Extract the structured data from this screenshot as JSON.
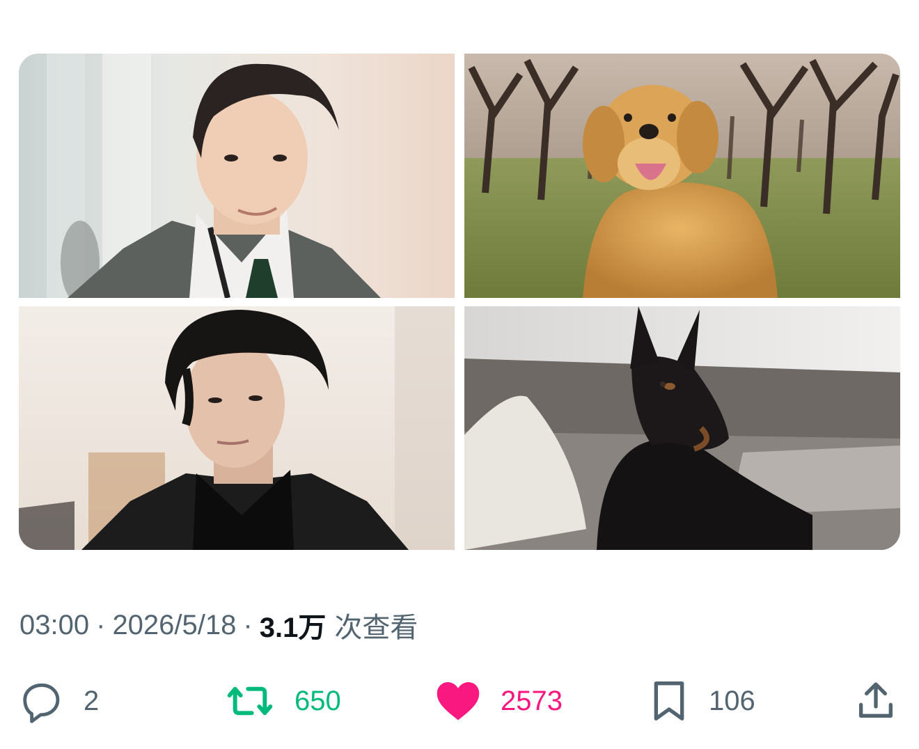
{
  "tweet": {
    "media": [
      {
        "name": "photo-man-grey-suit",
        "alt": ""
      },
      {
        "name": "photo-golden-retriever",
        "alt": ""
      },
      {
        "name": "photo-man-black-suit",
        "alt": ""
      },
      {
        "name": "photo-doberman",
        "alt": ""
      }
    ],
    "meta": {
      "time": "03:00",
      "separator": "·",
      "date": "2026/5/18",
      "views_count": "3.1万",
      "views_label": "次查看"
    },
    "actions": {
      "reply": {
        "icon": "reply-icon",
        "count": "2",
        "color": "#536471"
      },
      "retweet": {
        "icon": "retweet-icon",
        "count": "650",
        "color": "#00ba7c"
      },
      "like": {
        "icon": "heart-icon",
        "count": "2573",
        "color": "#f91880",
        "active": true
      },
      "bookmark": {
        "icon": "bookmark-icon",
        "count": "106",
        "color": "#536471"
      },
      "share": {
        "icon": "share-icon",
        "color": "#536471"
      }
    }
  }
}
